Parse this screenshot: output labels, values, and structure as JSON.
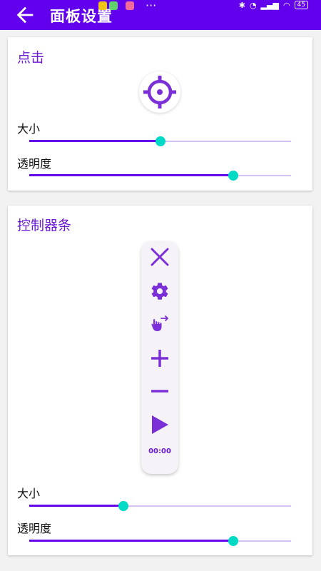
{
  "appbar": {
    "title": "面板设置",
    "more": "···",
    "battery": "45"
  },
  "click_section": {
    "title": "点击",
    "size_label": "大小",
    "size_value": 0.5,
    "opacity_label": "透明度",
    "opacity_value": 0.78
  },
  "control_section": {
    "title": "控制器条",
    "timer": "00:00",
    "buttons": [
      "close-icon",
      "gear-icon",
      "gesture-icon",
      "plus-icon",
      "minus-icon",
      "play-icon"
    ],
    "size_label": "大小",
    "size_value": 0.36,
    "opacity_label": "透明度",
    "opacity_value": 0.78
  },
  "colors": {
    "primary": "#6200ee",
    "accent": "#03dac5",
    "icon": "#7b2fd6"
  }
}
